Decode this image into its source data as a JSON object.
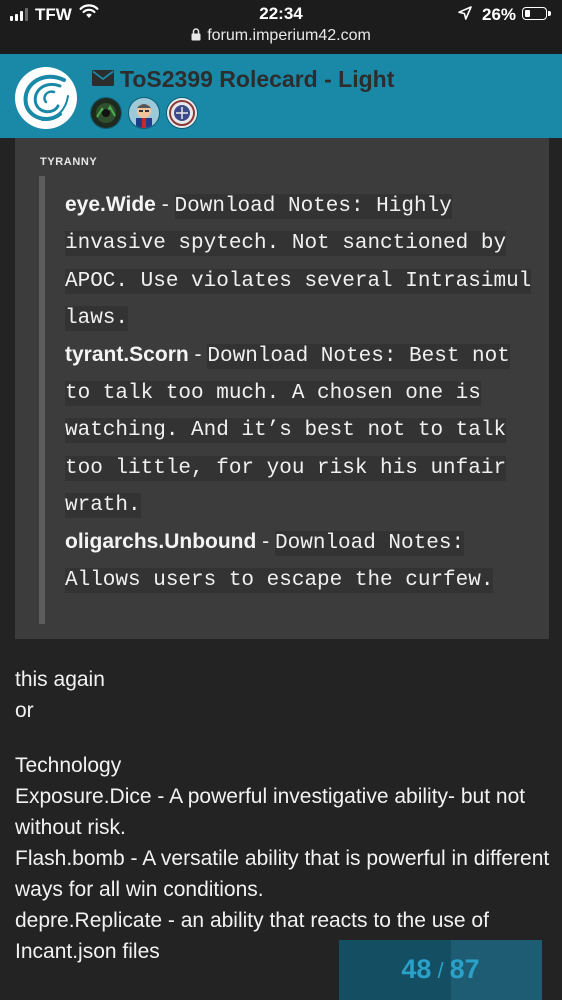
{
  "status_bar": {
    "carrier": "TFW",
    "time": "22:34",
    "battery": "26%",
    "battery_level": 0.26,
    "url": "forum.imperium42.com"
  },
  "header": {
    "title": "ToS2399 Rolecard - Light",
    "colors": {
      "bar": "#1a89a8",
      "title": "#2d2d2d"
    }
  },
  "quote": {
    "author": "TYRANNY",
    "items": [
      {
        "term": "eye.Wide",
        "sep": "-",
        "note": "Download Notes: Highly invasive spytech. Not sanctioned by APOC. Use violates several Intrasimul laws."
      },
      {
        "term": "tyrant.Scorn",
        "sep": "-",
        "note": "Download Notes: Best not to talk too much. A chosen one is watching. And it’s best not to talk too little, for you risk his unfair wrath."
      },
      {
        "term": "oligarchs.Unbound",
        "sep": "-",
        "note": "Download Notes: Allows users to escape the curfew."
      }
    ]
  },
  "post": {
    "lines_a": [
      "this again",
      "or"
    ],
    "lines_b": [
      "Technology",
      "Exposure.Dice - A powerful investigative ability- but not without risk.",
      "Flash.bomb - A versatile ability that is powerful in different ways for all win conditions.",
      "depre.Replicate - an ability that reacts to the use of Incant.json files"
    ]
  },
  "progress": {
    "current": "48",
    "separator": "/",
    "total": "87",
    "fraction": 0.55,
    "colors": {
      "text": "#2aa1c8",
      "bg": "#1d5c73"
    }
  }
}
